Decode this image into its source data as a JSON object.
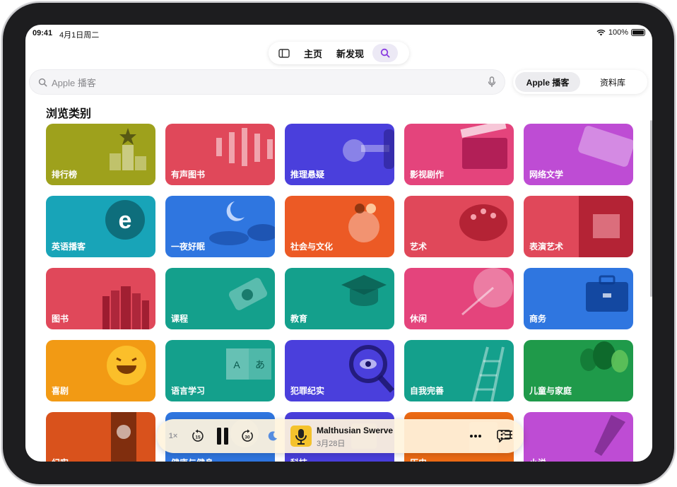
{
  "status_bar": {
    "time": "09:41",
    "date": "4月1日周二",
    "battery": "100%"
  },
  "top_nav": {
    "tabs": [
      "主页",
      "新发现"
    ]
  },
  "search": {
    "placeholder": "Apple 播客"
  },
  "scope": {
    "options": [
      "Apple 播客",
      "资料库"
    ],
    "selected": "Apple 播客"
  },
  "section_title": "浏览类别",
  "categories": [
    {
      "label": "排行榜",
      "color": "#9ea11c",
      "icon": "podium-star-icon"
    },
    {
      "label": "有声图书",
      "color": "#e0485a",
      "icon": "audio-bars-icon"
    },
    {
      "label": "推理悬疑",
      "color": "#4a3fdc",
      "icon": "key-icon"
    },
    {
      "label": "影视剧作",
      "color": "#e4447c",
      "icon": "clapperboard-icon"
    },
    {
      "label": "网络文学",
      "color": "#be4cd4",
      "icon": "keyboard-icon"
    },
    {
      "label": "英语播客",
      "color": "#18a4b8",
      "icon": "speech-bubble-e-icon"
    },
    {
      "label": "一夜好眠",
      "color": "#2f76e0",
      "icon": "moon-clouds-icon"
    },
    {
      "label": "社会与文化",
      "color": "#ec5a25",
      "icon": "people-globe-icon"
    },
    {
      "label": "艺术",
      "color": "#e0485a",
      "icon": "palette-icon"
    },
    {
      "label": "表演艺术",
      "color": "#e0485a",
      "icon": "theater-stage-icon"
    },
    {
      "label": "图书",
      "color": "#e0485a",
      "icon": "books-icon"
    },
    {
      "label": "课程",
      "color": "#14a08c",
      "icon": "diploma-icon"
    },
    {
      "label": "教育",
      "color": "#14a08c",
      "icon": "graduation-cap-icon"
    },
    {
      "label": "休闲",
      "color": "#e4447c",
      "icon": "beach-umbrella-icon"
    },
    {
      "label": "商务",
      "color": "#2f76e0",
      "icon": "briefcase-icon"
    },
    {
      "label": "喜剧",
      "color": "#f29a14",
      "icon": "laughing-face-icon"
    },
    {
      "label": "语言学习",
      "color": "#14a08c",
      "icon": "language-book-icon"
    },
    {
      "label": "犯罪纪实",
      "color": "#4a3fdc",
      "icon": "magnifier-eye-icon"
    },
    {
      "label": "自我完善",
      "color": "#14a08c",
      "icon": "ladder-icon"
    },
    {
      "label": "儿童与家庭",
      "color": "#1f9a4a",
      "icon": "balloons-icon"
    },
    {
      "label": "纪实",
      "color": "#d9521c",
      "icon": "film-globe-icon"
    },
    {
      "label": "健康与健身",
      "color": "#2f76e0",
      "icon": "health-icon"
    },
    {
      "label": "科技",
      "color": "#4a3fdc",
      "icon": "chip-icon"
    },
    {
      "label": "历史",
      "color": "#ec6a14",
      "icon": "history-icon"
    },
    {
      "label": "小说",
      "color": "#be4cd4",
      "icon": "fountain-pen-icon"
    }
  ],
  "now_playing": {
    "speed": "1×",
    "title": "Malthusian Swerve",
    "date": "3月28日",
    "accent": "#f4c22c"
  }
}
